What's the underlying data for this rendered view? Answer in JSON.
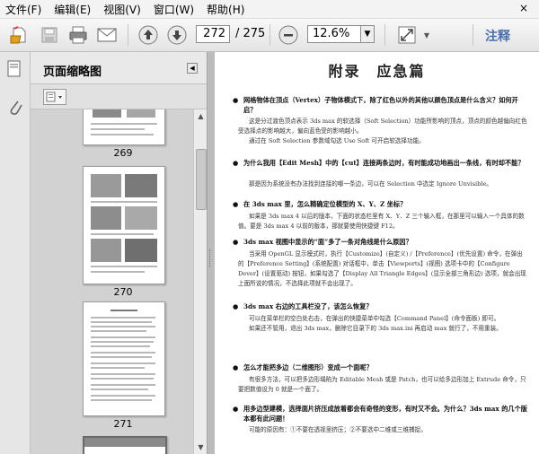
{
  "menu": {
    "items": [
      "文件(F)",
      "编辑(E)",
      "视图(V)",
      "窗口(W)",
      "帮助(H)"
    ],
    "close_glyph": "×"
  },
  "toolbar": {
    "current_page": "272",
    "total_pages": "/ 275",
    "zoom": "12.6%",
    "comment_label": "注释",
    "icons": [
      "open-icon",
      "save-icon",
      "print-icon",
      "email-icon",
      "prev-page-icon",
      "next-page-icon",
      "zoom-out-icon",
      "fit-page-icon"
    ]
  },
  "panel": {
    "title": "页面缩略图",
    "thumbnails": [
      {
        "number": "269"
      },
      {
        "number": "270"
      },
      {
        "number": "271"
      }
    ]
  },
  "document": {
    "heading": "附录　应急篇",
    "sections": [
      {
        "question": "网格物体在顶点（Vertex）子物体模式下，除了红色以外的其他以颜色顶点是什么含义？如何开启？",
        "answer": [
          "这是分过渡色顶点表示 3ds max 的软选择（Soft Selection）功能所影响的顶点，顶点的颜色越偏向红色受选择点的影响越大，偏向蓝色受的影响越小。",
          "通过在 Soft Selection 参数域勾选 Use Soft 可开启软选择功能。"
        ]
      },
      {
        "question": "为什么我用【Edit Mesh】中的【cut】连接两条边时，有时能成功地画出一条线，有时却不能？",
        "answer": [
          "那是因为系统没有办法找到连接的哪一条边，可以在 Selection 中选定 Ignore Unvisible。"
        ]
      },
      {
        "question": "在 3ds max 里，怎么精确定位模型的 X、Y、Z 坐标？",
        "answer": [
          "如果是 3ds max 4 以后的版本，下面的状态栏里有 X、Y、Z 三个输入框，在那里可以输入一个具体的数值。要是 3ds max 4 以前的版本，那就要使用快捷键 F12。"
        ]
      },
      {
        "question": "3ds max 视图中显示的“面”多了一条对角线是什么原因？",
        "answer": [
          "当采用 OpenGL 显示模式时，执行【Customize】(自定义) /【Preference】(优先设置) 命令，在弹出的【Preference Setting】(系统配置) 对话框中，单击【Viewports】(视图) 选项卡中的【Configure Dever】(设置驱动) 按钮，如果勾选了【Display All Triangle Edges】(显示全部三角形边) 选项，就会出现上面所说的情况，不选择此项就不会出现了。"
        ]
      },
      {
        "question": "3ds max 右边的工具栏没了，该怎么恢复？",
        "answer": [
          "可以在菜单栏的空白处右击，在弹出的快捷菜单中勾选【Command Panel】(命令面板) 即可。",
          "如果还不管用，退出 3ds max，删除它目录下的 3ds max.ini 再启动 max 就行了，不用重装。"
        ]
      },
      {
        "question": "怎么才能把多边（二维图形）变成一个面呢？",
        "answer": [
          "有很多方法，可以把多边形塌陷为 Editable Mesh 或是 Patch，也可以给多边形加上 Extrude 命令，只要把数值设为 0 就是一个面了。"
        ]
      },
      {
        "question": "用多边型建模，选择面片挤压成放着都会有奇怪的变形，有时又不会。为什么？3ds max 的几个版本都有此问题！",
        "answer": [
          "可能的原因有：①不要在透视里挤压；②不要选中二维或三维捕捉。"
        ]
      }
    ]
  }
}
